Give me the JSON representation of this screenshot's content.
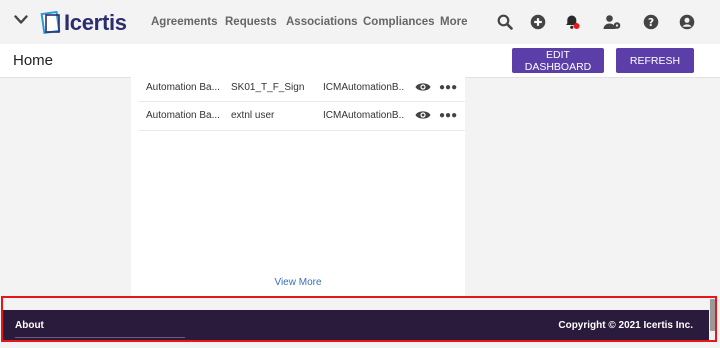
{
  "nav": {
    "logo_text": "Icertis",
    "links": [
      "Agreements",
      "Requests",
      "Associations",
      "Compliances",
      "More"
    ],
    "icons": [
      "search-icon",
      "add-circle-icon",
      "notification-bell-icon",
      "user-settings-icon",
      "help-icon",
      "account-icon"
    ],
    "notification_dot_color": "#e8151b"
  },
  "header": {
    "title": "Home",
    "edit_dashboard_label": "EDIT DASHBOARD",
    "refresh_label": "REFRESH",
    "button_color": "#5c3ea8"
  },
  "widget": {
    "rows": [
      {
        "name": "Automation Ba...",
        "template": "SK01_T_F_Sign",
        "created_by": "ICMAutomationB..."
      },
      {
        "name": "Automation Ba...",
        "template": "extnl user",
        "created_by": "ICMAutomationB..."
      }
    ],
    "row_icons": [
      "eye-icon",
      "more-icon"
    ],
    "view_more_label": "View More"
  },
  "footer": {
    "about_label": "About",
    "copyright": "Copyright © 2021 Icertis Inc.",
    "background_color": "#2a1b3d",
    "highlight_color": "#e8151b"
  }
}
